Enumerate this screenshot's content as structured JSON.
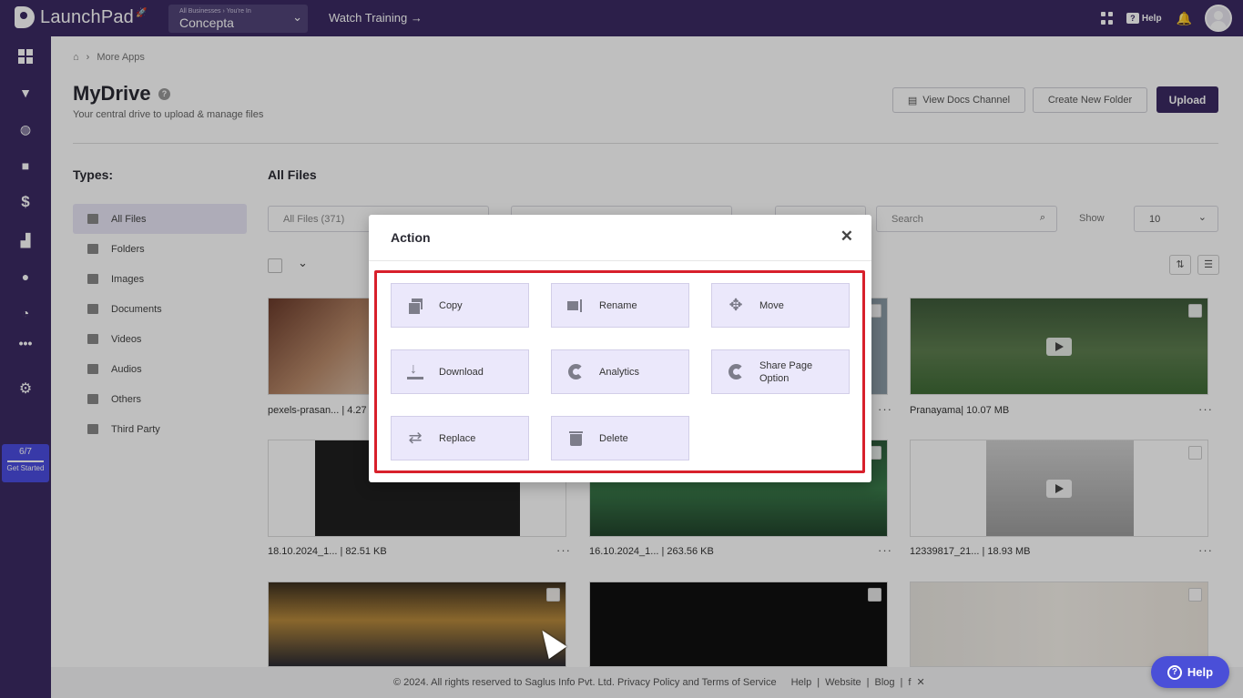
{
  "topbar": {
    "logo": "LaunchPad",
    "business_caption": "All Businesses › You're In",
    "business_name": "Concepta",
    "watch_training": "Watch Training →",
    "help": "Help"
  },
  "sidebar": {
    "icons": [
      "dashboard-icon",
      "funnel-icon",
      "globe-icon",
      "video-icon",
      "dollar-icon",
      "analytics-icon",
      "users-icon",
      "reports-icon",
      "more-icon",
      "settings-icon"
    ],
    "get_started_count": "6/7",
    "get_started_label": "Get Started"
  },
  "breadcrumb": {
    "current": "More Apps"
  },
  "page": {
    "title": "MyDrive",
    "subtitle": "Your central drive to upload & manage files",
    "view_docs": "View Docs Channel",
    "create_folder": "Create New Folder",
    "upload": "Upload"
  },
  "types": {
    "heading": "Types:",
    "items": [
      {
        "label": "All Files"
      },
      {
        "label": "Folders"
      },
      {
        "label": "Images"
      },
      {
        "label": "Documents"
      },
      {
        "label": "Videos"
      },
      {
        "label": "Audios"
      },
      {
        "label": "Others"
      },
      {
        "label": "Third Party"
      }
    ]
  },
  "files": {
    "heading": "All Files",
    "filter_value": "All Files (371)",
    "search_placeholder": "Search",
    "show_label": "Show",
    "show_value": "10",
    "items": [
      {
        "caption": "pexels-prasan... | 4.27"
      },
      {
        "caption": ""
      },
      {
        "caption": "Pranayama| 10.07 MB"
      },
      {
        "caption": "18.10.2024_1... | 82.51 KB"
      },
      {
        "caption": "16.10.2024_1... | 263.56 KB"
      },
      {
        "caption": "12339817_21... | 18.93 MB"
      }
    ]
  },
  "modal": {
    "title": "Action",
    "actions": [
      {
        "label": "Copy",
        "icon": "copy-icon"
      },
      {
        "label": "Rename",
        "icon": "rename-icon"
      },
      {
        "label": "Move",
        "icon": "move-icon"
      },
      {
        "label": "Download",
        "icon": "download-icon"
      },
      {
        "label": "Analytics",
        "icon": "analytics-icon"
      },
      {
        "label": "Share Page Option",
        "icon": "share-icon"
      },
      {
        "label": "Replace",
        "icon": "replace-icon"
      },
      {
        "label": "Delete",
        "icon": "delete-icon"
      }
    ]
  },
  "footer": {
    "copyright": "© 2024. All rights reserved to Saglus Info Pvt. Ltd. Privacy Policy and Terms of Service",
    "help": "Help",
    "website": "Website",
    "blog": "Blog"
  },
  "help_float": "Help",
  "colors": {
    "brand": "#3b2a63",
    "accent": "#4a4fd8",
    "highlight": "#d8202b",
    "action_bg": "#ebe8fb"
  }
}
